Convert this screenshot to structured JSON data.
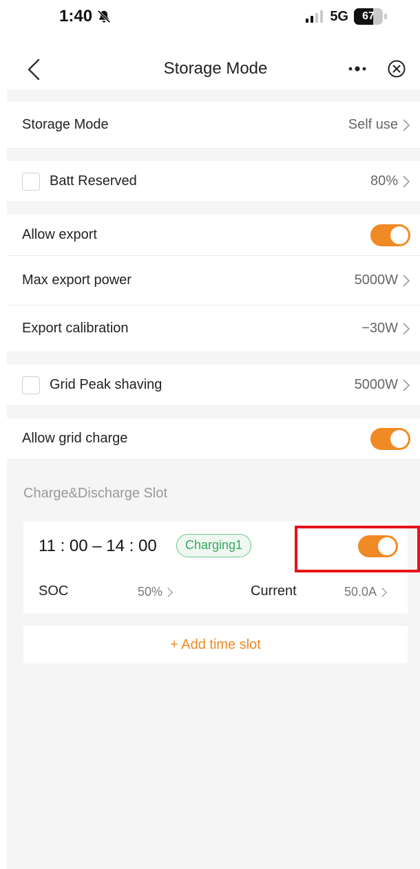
{
  "status_bar": {
    "time": "1:40",
    "network": "5G",
    "battery_level": "67",
    "battery_fraction": 0.67
  },
  "header": {
    "title": "Storage Mode",
    "icons": [
      "back-chevron-icon",
      "more-dots-icon",
      "close-circle-icon"
    ]
  },
  "settings": {
    "storage_mode": {
      "label": "Storage Mode",
      "value": "Self use"
    },
    "batt_reserved": {
      "label": "Batt Reserved",
      "value": "80%",
      "checked": false
    },
    "allow_export": {
      "label": "Allow export",
      "enabled": true
    },
    "max_export_power": {
      "label": "Max export power",
      "value": "5000W"
    },
    "export_calibration": {
      "label": "Export calibration",
      "value": "−30W"
    },
    "grid_peak_shaving": {
      "label": "Grid Peak shaving",
      "value": "5000W",
      "checked": false
    },
    "allow_grid_charge": {
      "label": "Allow grid charge",
      "enabled": true
    }
  },
  "slots_section": {
    "title": "Charge&Discharge Slot",
    "slots": [
      {
        "time_range": "11 : 00 – 14 : 00",
        "badge": "Charging1",
        "enabled": true,
        "soc_label": "SOC",
        "soc_value": "50%",
        "current_label": "Current",
        "current_value": "50.0A"
      }
    ],
    "add_label": "+ Add time slot"
  },
  "colors": {
    "accent": "#f08a24",
    "badge_green": "#3aa763",
    "highlight_red": "#e8121a"
  }
}
